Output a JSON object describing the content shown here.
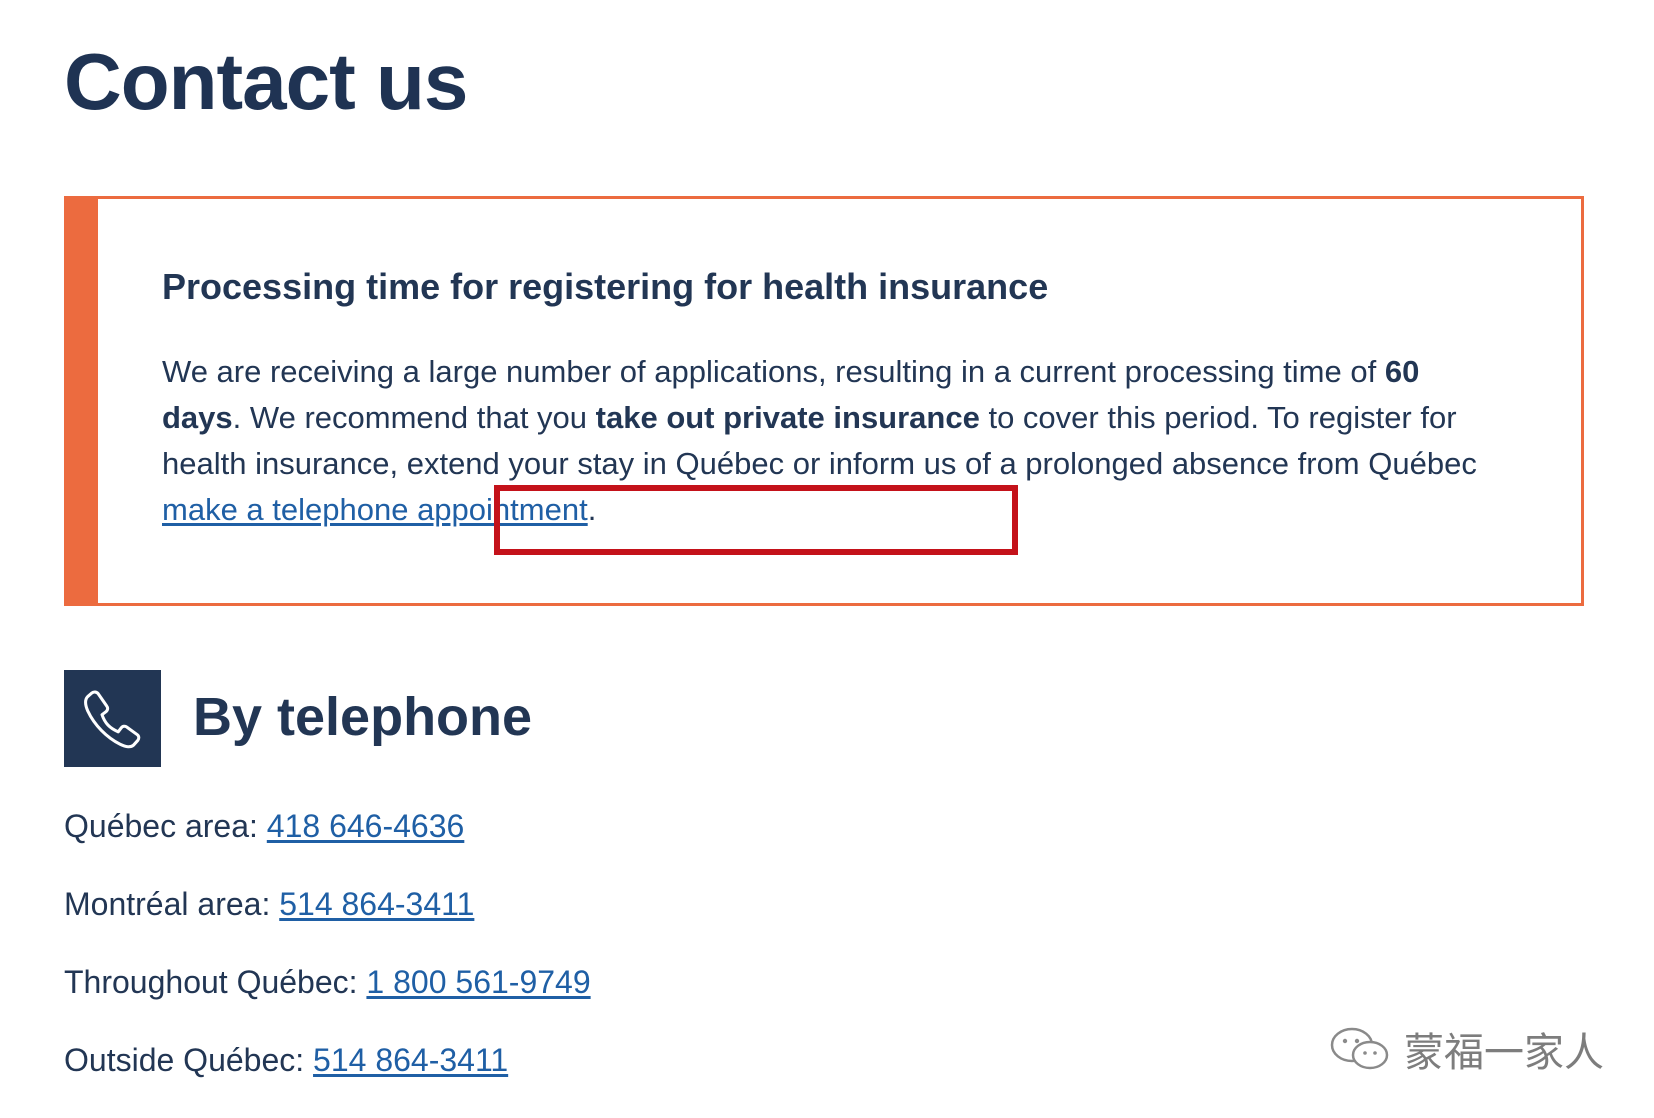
{
  "page": {
    "title": "Contact us"
  },
  "alert": {
    "title": "Processing time for registering for health insurance",
    "text_1": "We are receiving a large number of applications, resulting in a current processing time of ",
    "bold_days": "60 days",
    "text_2": ". We recommend that you ",
    "bold_insurance": "take out private insurance",
    "text_3": " to cover this period. To register for health insurance, extend your stay in Québec or inform us of a prolonged absence from Québec ",
    "link_label": "make a telephone appointment",
    "text_4": ".",
    "accent_color": "#ec6b3f",
    "highlight_color": "#c4121a"
  },
  "telephone": {
    "icon": "phone-icon",
    "title": "By telephone",
    "lines": [
      {
        "label": "Québec area: ",
        "number": "418 646-4636"
      },
      {
        "label": "Montréal area: ",
        "number": "514 864-3411"
      },
      {
        "label": "Throughout Québec: ",
        "number": "1 800 561-9749"
      },
      {
        "label": "Outside Québec: ",
        "number": "514 864-3411"
      }
    ]
  },
  "watermark": {
    "icon": "wechat-icon",
    "text": "蒙福一家人"
  },
  "colors": {
    "text": "#223654",
    "link": "#1f5fa5",
    "icon_background": "#223654"
  }
}
